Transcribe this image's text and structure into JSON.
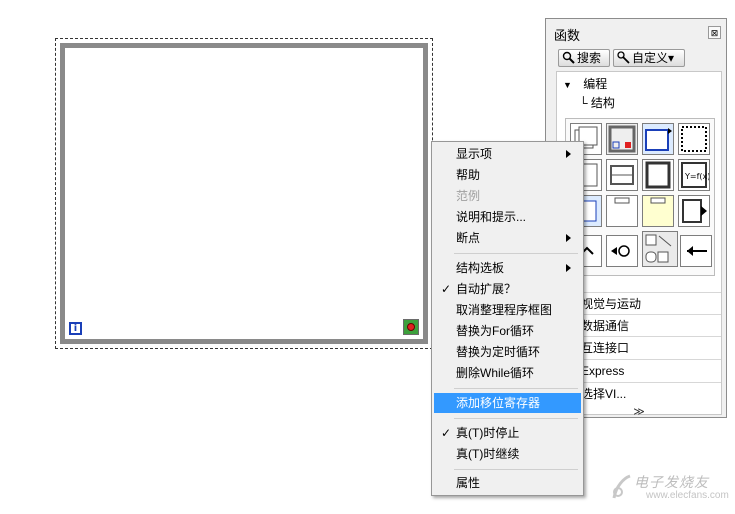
{
  "palette": {
    "title": "函数",
    "close_glyph": "⊠",
    "search_label": "搜索",
    "customize_label": "自定义▾",
    "tree_root": "编程",
    "tree_child": "结构",
    "subpalettes": [
      "视觉与运动",
      "数据通信",
      "互连接口",
      "Express",
      "选择VI..."
    ],
    "more_glyph": "≫"
  },
  "while_loop": {
    "iteration_label": "i"
  },
  "context_menu": {
    "items": [
      {
        "label": "显示项",
        "submenu": true
      },
      {
        "label": "帮助"
      },
      {
        "label": "范例",
        "disabled": true
      },
      {
        "label": "说明和提示..."
      },
      {
        "label": "断点",
        "submenu": true
      },
      {
        "label": "结构选板",
        "submenu": true
      },
      {
        "label": "自动扩展？",
        "checked": true
      },
      {
        "label": "取消整理程序框图"
      },
      {
        "label": "替换为For循环"
      },
      {
        "label": "替换为定时循环"
      },
      {
        "label": "删除While循环"
      },
      {
        "label": "添加移位寄存器",
        "highlighted": true
      },
      {
        "label": "真(T)时停止",
        "checked": true
      },
      {
        "label": "真(T)时继续"
      },
      {
        "label": "属性"
      }
    ],
    "check_glyph": "✓",
    "highlight_color": "#3399ff"
  },
  "watermark": {
    "text": "电子发烧友",
    "url": "www.elecfans.com"
  },
  "colors": {
    "loop_border": "#8a8a8a",
    "iteration_blue": "#1a3fb8",
    "stop_red": "#e02020",
    "stop_green": "#3ca03c"
  }
}
